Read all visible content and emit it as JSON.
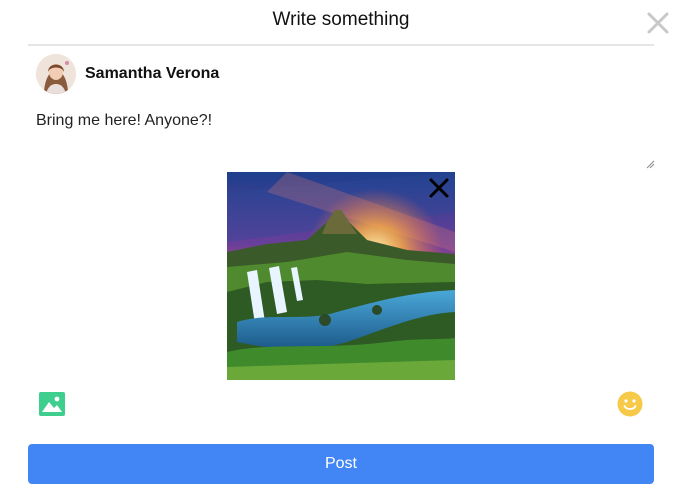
{
  "modal": {
    "title": "Write something",
    "close_icon": "close-icon"
  },
  "author": {
    "name": "Samantha Verona",
    "avatar_icon": "avatar-photo"
  },
  "composer": {
    "text": "Bring me here! Anyone?!"
  },
  "attachment": {
    "type": "photo",
    "subject": "mountain-waterfall-sunset",
    "remove_icon": "close-icon"
  },
  "toolbar": {
    "image_icon": "image-icon",
    "emoji_icon": "emoji-smile-icon"
  },
  "actions": {
    "post_label": "Post"
  },
  "colors": {
    "primary": "#4285f4",
    "image_icon": "#3ecf8e",
    "emoji_icon": "#f7c948",
    "close_icon": "#c8c8c8"
  }
}
